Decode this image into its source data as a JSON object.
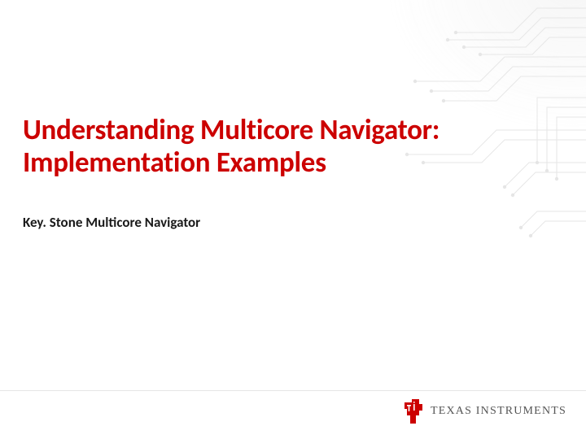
{
  "title": "Understanding Multicore Navigator: Implementation Examples",
  "subtitle": "Key. Stone Multicore Navigator",
  "footer": {
    "company": "TEXAS INSTRUMENTS"
  },
  "colors": {
    "title": "#cc0000",
    "logo": "#cc0000",
    "subtitle": "#1a1a1a",
    "company_text": "#555555"
  }
}
